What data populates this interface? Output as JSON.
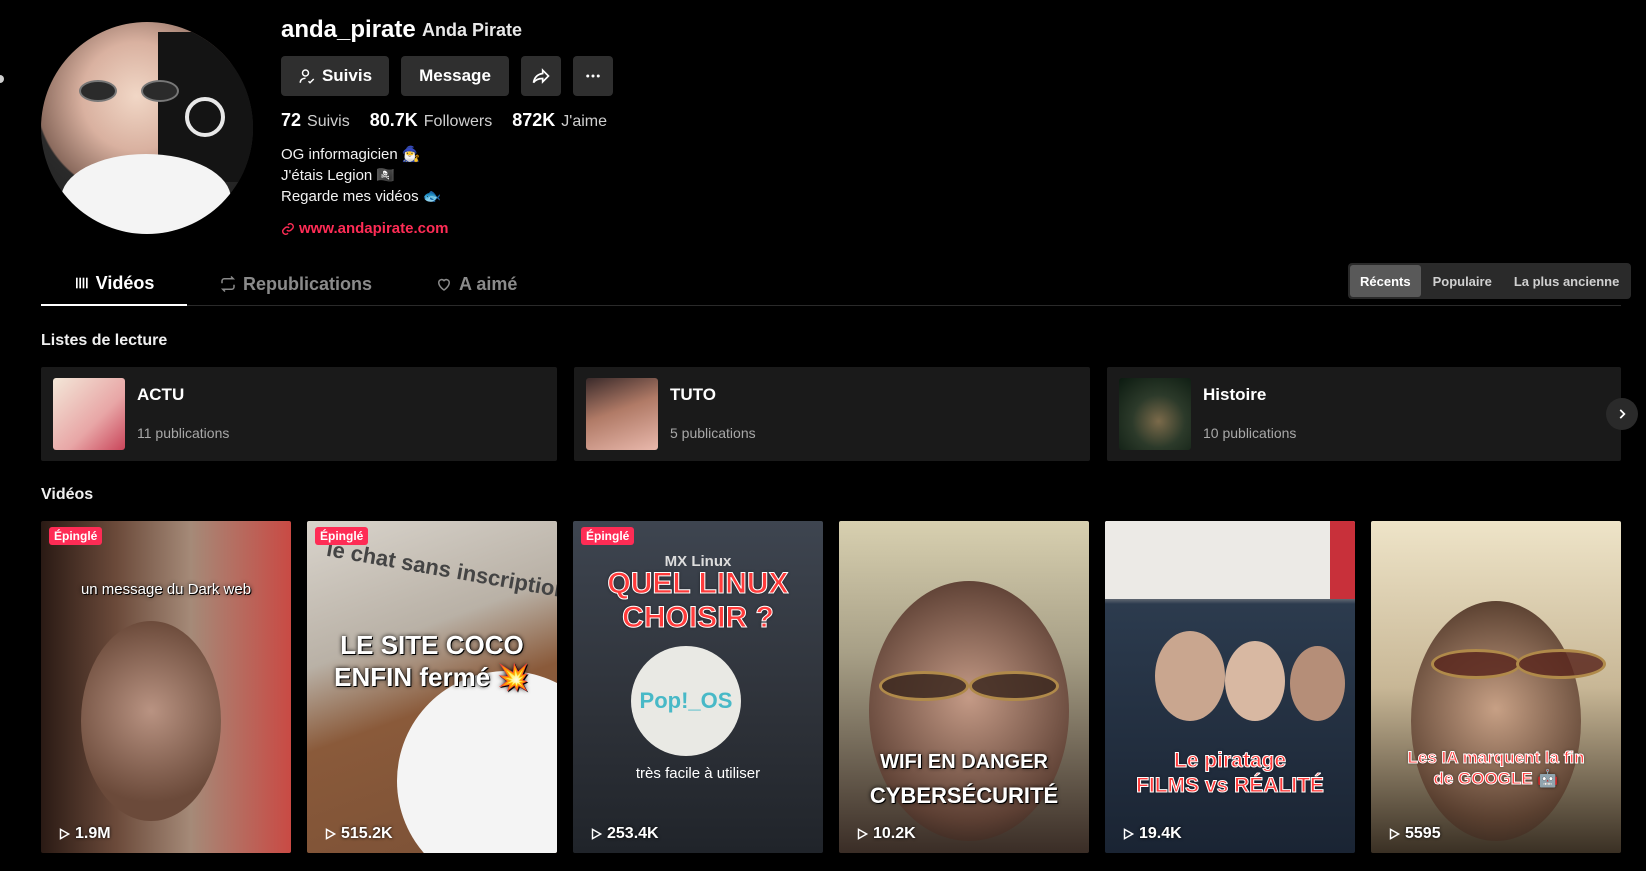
{
  "profile": {
    "username": "anda_pirate",
    "display_name": "Anda Pirate",
    "follow_button": "Suivis",
    "message_button": "Message",
    "stats": {
      "following_count": "72",
      "following_label": "Suivis",
      "followers_count": "80.7K",
      "followers_label": "Followers",
      "likes_count": "872K",
      "likes_label": "J'aime"
    },
    "bio": [
      "OG informagicien 🧙‍♂️",
      "J'étais Legion 🏴‍☠️",
      "Regarde mes vidéos 🐟"
    ],
    "website": "www.andapirate.com"
  },
  "tabs": [
    {
      "label": "Vidéos",
      "active": true
    },
    {
      "label": "Republications",
      "active": false
    },
    {
      "label": "A aimé",
      "active": false
    }
  ],
  "sort": {
    "options": [
      "Récents",
      "Populaire",
      "La plus ancienne"
    ],
    "selected": "Récents"
  },
  "playlists": {
    "title": "Listes de lecture",
    "items": [
      {
        "name": "ACTU",
        "count": "11 publications"
      },
      {
        "name": "TUTO",
        "count": "5 publications"
      },
      {
        "name": "Histoire",
        "count": "10 publications"
      }
    ]
  },
  "videos": {
    "title": "Vidéos",
    "pinned_label": "Épinglé",
    "items": [
      {
        "caption": "un message du Dark web",
        "views": "1.9M",
        "pinned": true
      },
      {
        "caption": "LE SITE COCO ENFIN fermé 💥",
        "overlay": "le chat sans inscription",
        "views": "515.2K",
        "pinned": true
      },
      {
        "caption": "QUEL LINUX CHOISIR ?",
        "overlay_top": "MX Linux",
        "overlay_bottom": "très facile à utiliser",
        "logo_text": "Pop!_OS",
        "views": "253.4K",
        "pinned": true
      },
      {
        "caption": "WIFI EN DANGER",
        "caption2": "CYBERSÉCURITÉ",
        "views": "10.2K",
        "pinned": false
      },
      {
        "caption": "Le piratage",
        "caption2": "FILMS vs RÉALITÉ",
        "views": "19.4K",
        "pinned": false
      },
      {
        "caption": "Les IA marquent la fin de GOOGLE 🤖",
        "views": "5595",
        "pinned": false
      }
    ]
  },
  "colors": {
    "accent": "#fe2c55",
    "background": "#000000",
    "surface": "#1a1a1a"
  }
}
